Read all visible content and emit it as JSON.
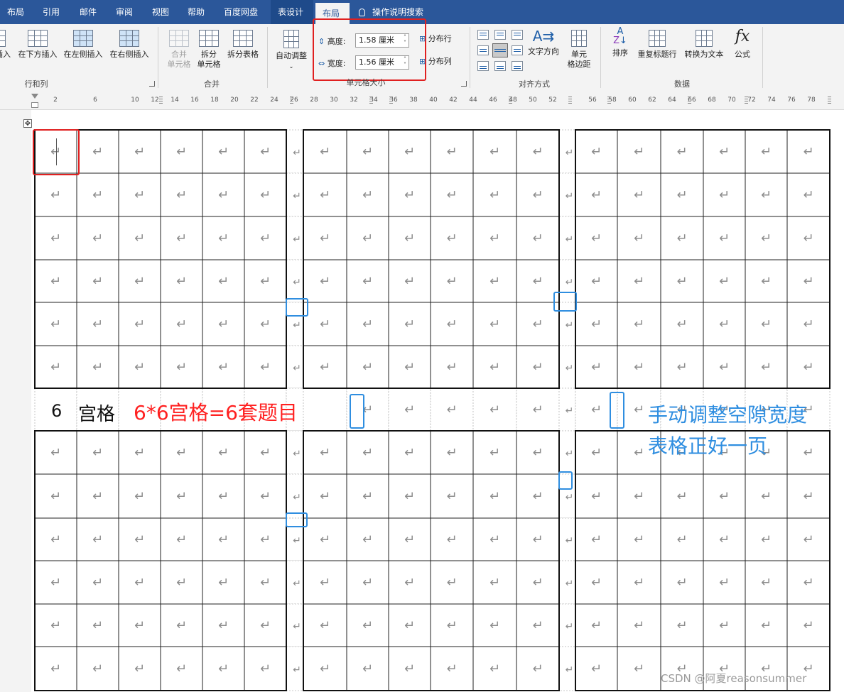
{
  "tabs": [
    "布局",
    "引用",
    "邮件",
    "审阅",
    "视图",
    "帮助",
    "百度网盘",
    "表设计",
    "布局"
  ],
  "tell_me": "操作说明搜索",
  "ribbon": {
    "rows_cols": {
      "buttons": [
        "插入",
        "在下方插入",
        "在左侧插入",
        "在右侧插入"
      ],
      "group_label": "行和列"
    },
    "merge": {
      "merge_cells": [
        "合并",
        "单元格"
      ],
      "split_cells": [
        "拆分",
        "单元格"
      ],
      "split_table": "拆分表格",
      "group_label": "合并"
    },
    "cell_size": {
      "autofit": "自动调整",
      "height_label": "高度:",
      "height_value": "1.58 厘米",
      "width_label": "宽度:",
      "width_value": "1.56 厘米",
      "distribute_rows": "分布行",
      "distribute_cols": "分布列",
      "group_label": "单元格大小"
    },
    "alignment": {
      "text_direction": "文字方向",
      "cell_margins": [
        "单元",
        "格边距"
      ],
      "group_label": "对齐方式"
    },
    "data": {
      "sort": "排序",
      "repeat_header": "重复标题行",
      "convert_text": "转换为文本",
      "formula": "公式",
      "group_label": "数据"
    }
  },
  "ruler_numbers": [
    "2",
    "6",
    "10",
    "12",
    "14",
    "16",
    "18",
    "20",
    "22",
    "24",
    "26",
    "28",
    "30",
    "32",
    "34",
    "36",
    "38",
    "40",
    "42",
    "44",
    "46",
    "48",
    "50",
    "52",
    "56",
    "58",
    "60",
    "62",
    "64",
    "66",
    "68",
    "70",
    "72",
    "74",
    "76",
    "78"
  ],
  "doc": {
    "paragraph_mark": "↵",
    "row_label": "6",
    "row_label_word": "宫格",
    "red_annotation": "6*6宫格=6套题目",
    "blue_annotation_line1": "手动调整空隙宽度",
    "blue_annotation_line2": "表格正好一页",
    "watermark": "CSDN @阿夏reasonsummer"
  },
  "colors": {
    "tab_bar": "#2b579a",
    "highlight_red": "#e02020",
    "annotation_red": "#ff2020",
    "annotation_blue": "#2f8ee0"
  },
  "icons": [
    "insert-below-icon",
    "insert-left-icon",
    "insert-right-icon",
    "merge-cells-icon",
    "split-cells-icon",
    "split-table-icon",
    "autofit-icon",
    "height-icon",
    "width-icon",
    "distribute-rows-icon",
    "distribute-cols-icon",
    "align-icon",
    "text-direction-icon",
    "cell-margins-icon",
    "sort-icon",
    "repeat-header-icon",
    "convert-text-icon",
    "formula-icon",
    "lightbulb-icon",
    "table-move-handle-icon"
  ]
}
